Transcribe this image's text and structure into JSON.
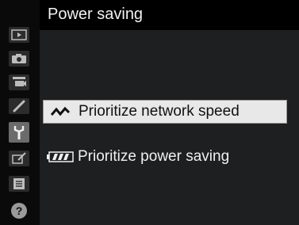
{
  "header": {
    "title": "Power saving"
  },
  "sidebar": {
    "items": [
      {
        "icon": "playback-menu-icon",
        "state": "normal"
      },
      {
        "icon": "photo-shooting-menu-icon",
        "state": "normal"
      },
      {
        "icon": "movie-shooting-menu-icon",
        "state": "normal"
      },
      {
        "icon": "custom-settings-pencil-icon",
        "state": "normal"
      },
      {
        "icon": "setup-menu-wrench-icon",
        "state": "active"
      },
      {
        "icon": "retouch-menu-icon",
        "state": "normal"
      },
      {
        "icon": "my-menu-icon",
        "state": "normal"
      },
      {
        "icon": "help-icon",
        "state": "normal"
      }
    ]
  },
  "options": [
    {
      "label": "Prioritize network speed",
      "icon": "network-speed-icon",
      "selected": true
    },
    {
      "label": "Prioritize power saving",
      "icon": "battery-icon",
      "selected": false
    }
  ],
  "colors": {
    "background": "#000000",
    "panel": "#1e1f21",
    "highlight": "#e8e8e8",
    "active_tab": "#6b6b6b"
  }
}
